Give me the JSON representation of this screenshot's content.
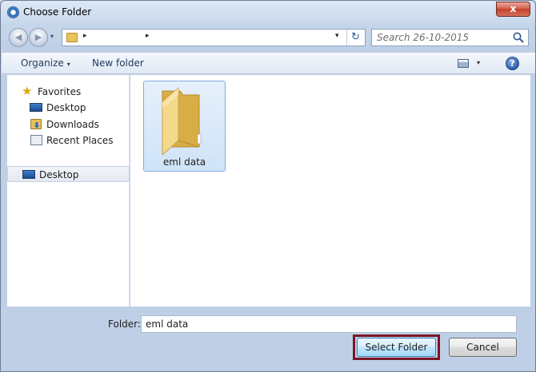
{
  "window": {
    "title": "Choose Folder",
    "close_glyph": "x"
  },
  "address_bar": {
    "separator": "▸",
    "dropdown_glyph": "▾",
    "refresh_glyph": "↻",
    "search_placeholder": "Search 26-10-2015"
  },
  "toolbar": {
    "organize_label": "Organize",
    "organize_arrow": "▾",
    "new_folder_label": "New folder",
    "views_arrow": "▾",
    "help_glyph": "?"
  },
  "navigation": {
    "favorites": "Favorites",
    "items": [
      "Desktop",
      "Downloads",
      "Recent Places"
    ],
    "selected": "Desktop"
  },
  "content": {
    "folders": [
      {
        "name": "eml data"
      }
    ]
  },
  "footer": {
    "folder_label": "Folder:",
    "folder_value": "eml data",
    "select_button": "Select Folder",
    "cancel_button": "Cancel"
  },
  "colors": {
    "highlight_border": "#7a1424",
    "selection_fill": "#cfe3f8",
    "close_button": "#c3412c",
    "folder_yellow": "#f2d27a"
  }
}
